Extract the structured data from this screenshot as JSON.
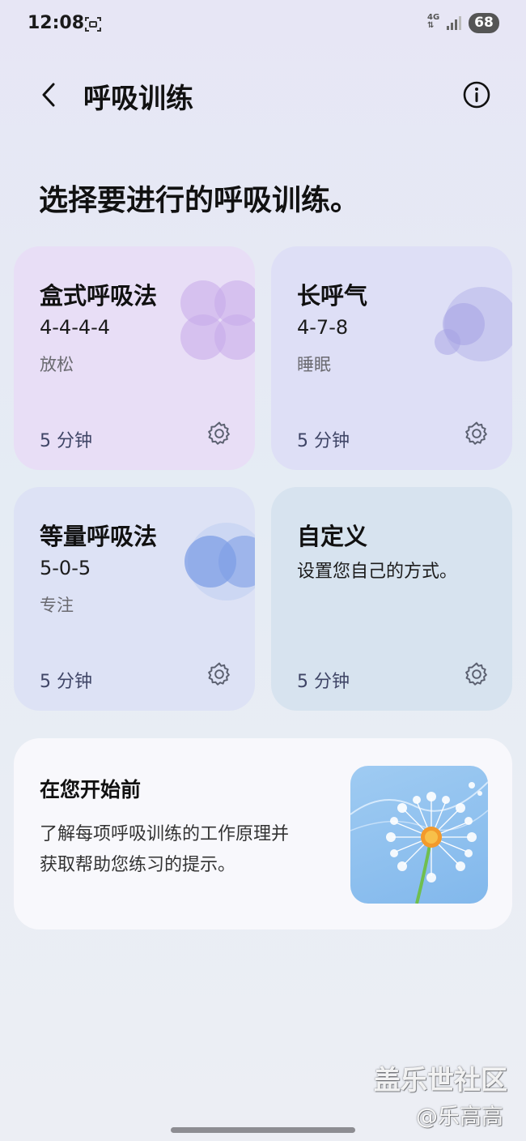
{
  "status_bar": {
    "time": "12:08",
    "network": "4G",
    "battery": "68"
  },
  "app_bar": {
    "title": "呼吸训练"
  },
  "heading": "选择要进行的呼吸训练。",
  "cards": [
    {
      "name": "盒式呼吸法",
      "pattern": "4-4-4-4",
      "purpose": "放松",
      "duration": "5 分钟"
    },
    {
      "name": "长呼气",
      "pattern": "4-7-8",
      "purpose": "睡眠",
      "duration": "5 分钟"
    },
    {
      "name": "等量呼吸法",
      "pattern": "5-0-5",
      "purpose": "专注",
      "duration": "5 分钟"
    },
    {
      "name": "自定义",
      "description": "设置您自己的方式。",
      "duration": "5 分钟"
    }
  ],
  "before_you_start": {
    "title": "在您开始前",
    "line1": "了解每项呼吸训练的工作原理并",
    "line2": "获取帮助您练习的提示。"
  },
  "watermark": {
    "line1": "盖乐世社区",
    "line2": "@乐高高"
  },
  "colors": {
    "card_box": "#e8def6",
    "card_long": "#dedff6",
    "card_equal": "#dde2f5",
    "card_custom": "#d7e3ef"
  }
}
